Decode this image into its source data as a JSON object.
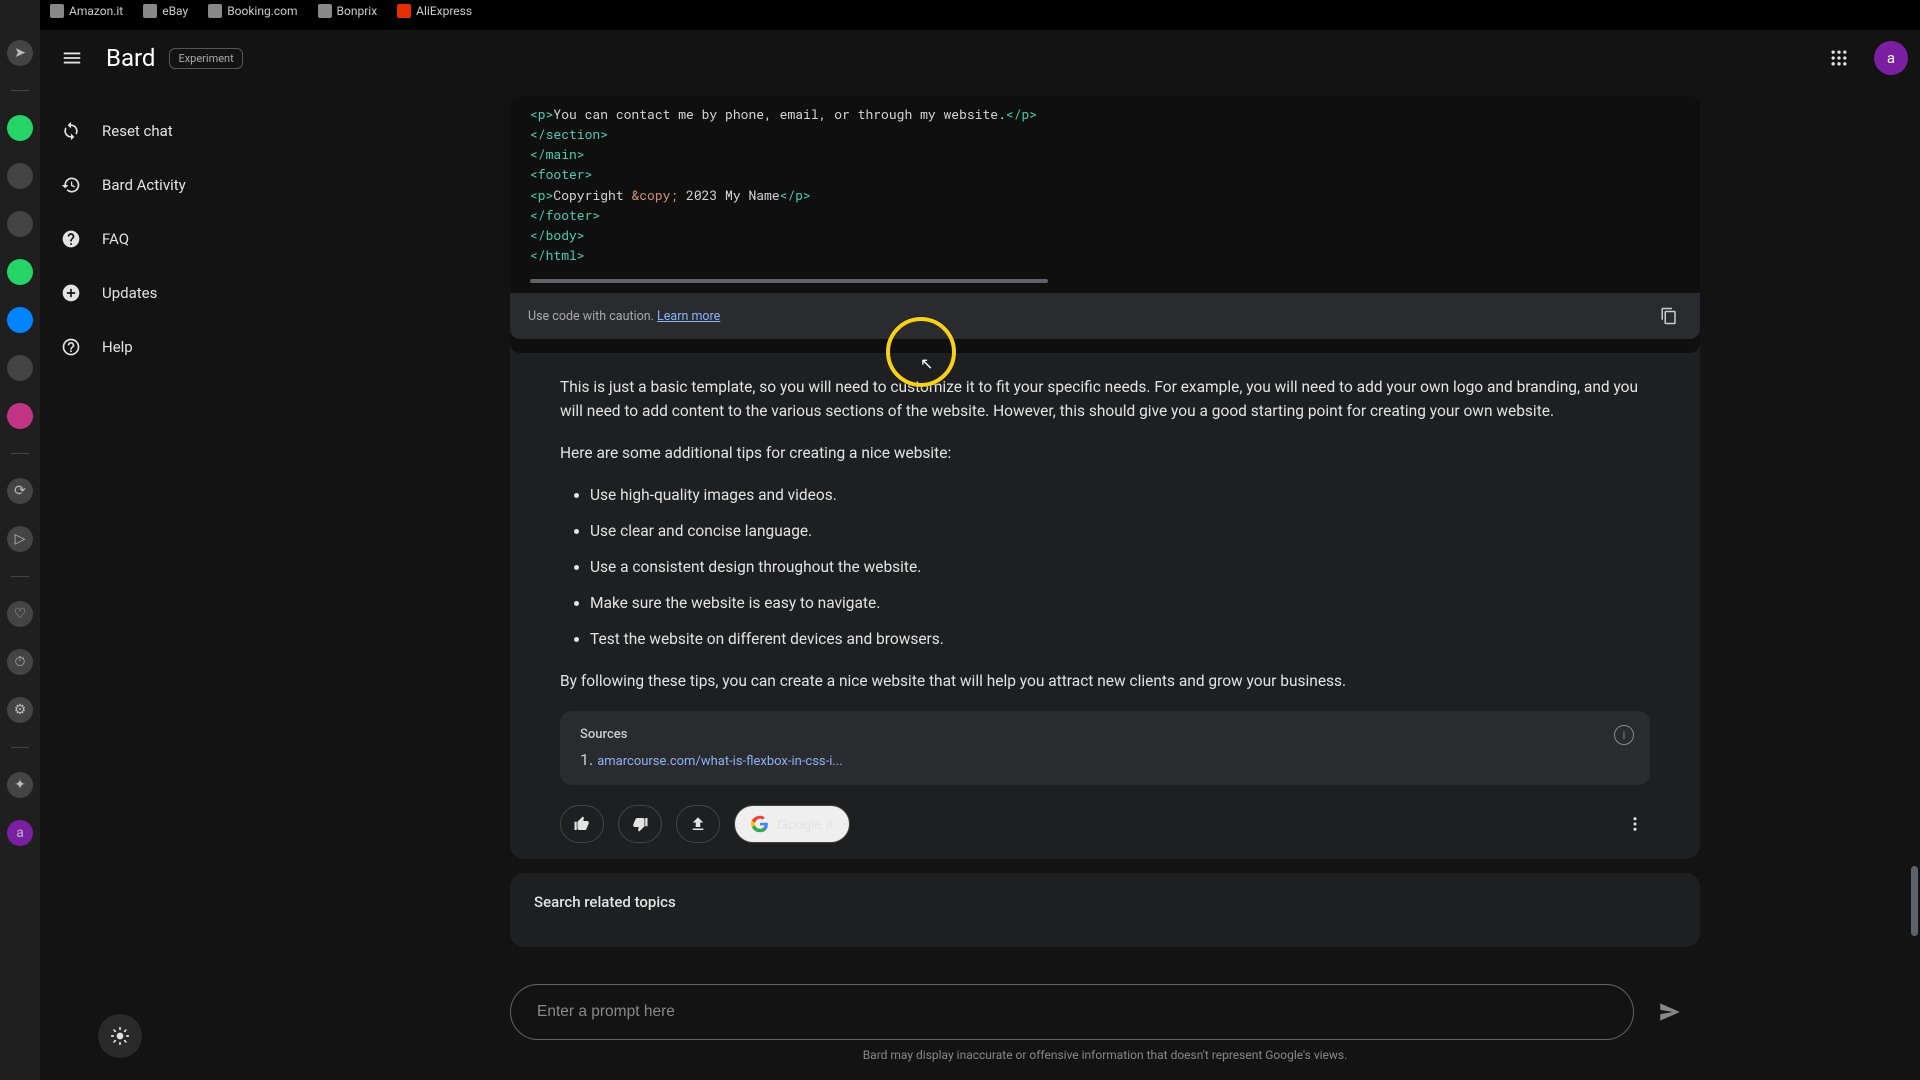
{
  "browser_bookmarks": [
    "Amazon.it",
    "eBay",
    "Booking.com",
    "Bonprix",
    "AliExpress"
  ],
  "header": {
    "brand": "Bard",
    "badge": "Experiment",
    "avatar_initial": "a"
  },
  "sidebar": {
    "items": [
      {
        "label": "Reset chat"
      },
      {
        "label": "Bard Activity"
      },
      {
        "label": "FAQ"
      },
      {
        "label": "Updates"
      },
      {
        "label": "Help"
      }
    ]
  },
  "code": {
    "lines_html": "&lt;p&gt;You can contact me by phone, email, or through my website.&lt;/p&gt;\n&lt;/section&gt;\n&lt;/main&gt;\n&lt;footer&gt;\n&lt;p&gt;Copyright &amp;copy; 2023 My Name&lt;/p&gt;\n&lt;/footer&gt;\n&lt;/body&gt;\n&lt;/html&gt;"
  },
  "caution": {
    "text": "Use code with caution. ",
    "link": "Learn more"
  },
  "response": {
    "para1": "This is just a basic template, so you will need to customize it to fit your specific needs. For example, you will need to add your own logo and branding, and you will need to add content to the various sections of the website. However, this should give you a good starting point for creating your own website.",
    "para2": "Here are some additional tips for creating a nice website:",
    "bullets": [
      "Use high-quality images and videos.",
      "Use clear and concise language.",
      "Use a consistent design throughout the website.",
      "Make sure the website is easy to navigate.",
      "Test the website on different devices and browsers."
    ],
    "para3": "By following these tips, you can create a nice website that will help you attract new clients and grow your business."
  },
  "sources": {
    "title": "Sources",
    "items": [
      {
        "num": "1.",
        "text": "amarcourse.com/what-is-flexbox-in-css-i..."
      }
    ]
  },
  "actions": {
    "google_it": "Google it"
  },
  "related": {
    "title": "Search related topics"
  },
  "input": {
    "placeholder": "Enter a prompt here"
  },
  "disclaimer": "Bard may display inaccurate or offensive information that doesn't represent Google's views."
}
